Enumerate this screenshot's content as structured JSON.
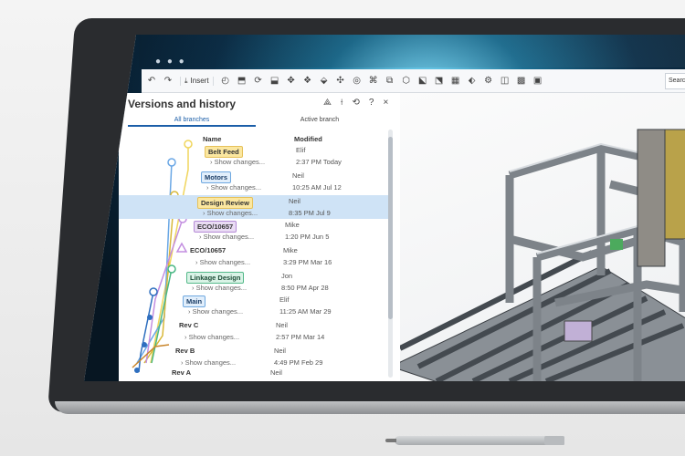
{
  "toolbar": {
    "insert_label": "Insert",
    "search_text": "Search t",
    "icons": [
      "undo-icon",
      "redo-icon",
      "insert-icon",
      "sketch-icon",
      "extrude-icon",
      "revolve-icon",
      "sweep-icon",
      "loft-icon",
      "fillet-icon",
      "chamfer-icon",
      "shell-icon",
      "hole-icon",
      "pattern-icon",
      "mirror-icon",
      "transform-icon",
      "boolean-icon",
      "split-icon",
      "plane-icon",
      "mate-icon",
      "gear-icon",
      "frame-icon",
      "grid-icon",
      "more-icon"
    ]
  },
  "panel": {
    "title": "Versions and history",
    "tabs": [
      "All branches",
      "Active branch"
    ],
    "columns": {
      "name": "Name",
      "modified": "Modified"
    },
    "rows": [
      {
        "label": "Belt Feed",
        "tag": "yellow",
        "show": "Show changes...",
        "who": "Elif",
        "when": "2:37 PM Today",
        "selected": false
      },
      {
        "label": "Motors",
        "tag": "blue",
        "show": "Show changes...",
        "who": "Neil",
        "when": "10:25 AM Jul 12",
        "selected": false
      },
      {
        "label": "Design Review",
        "tag": "yellow",
        "show": "Show changes...",
        "who": "Neil",
        "when": "8:35 PM Jul 9",
        "selected": true
      },
      {
        "label": "ECO/10657",
        "tag": "purple",
        "show": "Show changes...",
        "who": "Mike",
        "when": "1:20 PM Jun 5",
        "selected": false
      },
      {
        "label": "ECO/10657",
        "tag": "none",
        "show": "Show changes...",
        "who": "Mike",
        "when": "3:29 PM Mar 16",
        "selected": false
      },
      {
        "label": "Linkage Design",
        "tag": "green",
        "show": "Show changes...",
        "who": "Jon",
        "when": "8:50 PM Apr 28",
        "selected": false
      },
      {
        "label": "Main",
        "tag": "blue",
        "show": "Show changes...",
        "who": "Elif",
        "when": "11:25 AM Mar 29",
        "selected": false
      },
      {
        "label": "Rev C",
        "tag": "none",
        "show": "Show changes...",
        "who": "Neil",
        "when": "2:57 PM Mar 14",
        "selected": false
      },
      {
        "label": "Rev B",
        "tag": "none",
        "show": "Show changes...",
        "who": "Neil",
        "when": "4:49 PM Feb 29",
        "selected": false
      },
      {
        "label": "Rev A",
        "tag": "none",
        "show": "",
        "who": "Neil",
        "when": "",
        "selected": false
      }
    ]
  },
  "colors": {
    "yellow_tag_bg": "#fbe7a0",
    "yellow_tag_border": "#e6c15a",
    "blue_tag_bg": "#e1eefb",
    "blue_tag_border": "#6ea8e0",
    "purple_tag_bg": "#eadcf4",
    "purple_tag_border": "#b48ad6",
    "green_tag_bg": "#d9f3e6",
    "green_tag_border": "#54b98a",
    "selected_row": "#cfe3f6",
    "accent": "#1b5ea8"
  }
}
